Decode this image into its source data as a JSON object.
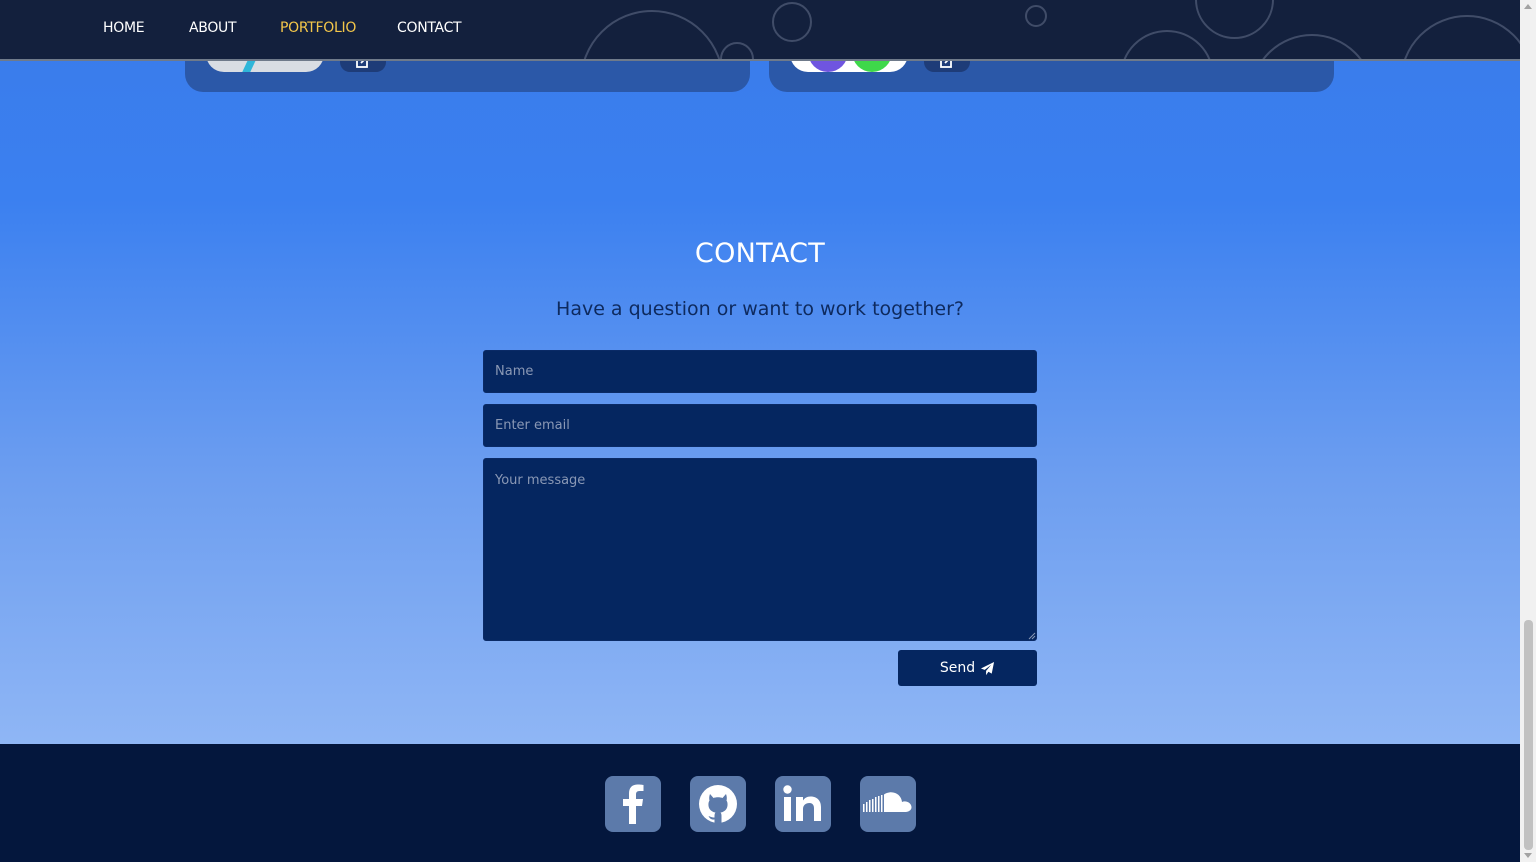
{
  "nav": {
    "items": [
      {
        "label": "HOME",
        "active": false
      },
      {
        "label": "ABOUT",
        "active": false
      },
      {
        "label": "PORTFOLIO",
        "active": true
      },
      {
        "label": "CONTACT",
        "active": false
      }
    ]
  },
  "contact": {
    "title": "CONTACT",
    "subtitle": "Have a question or want to work together?",
    "name_placeholder": "Name",
    "email_placeholder": "Enter email",
    "message_placeholder": "Your message",
    "send_label": "Send"
  },
  "footer": {
    "social": [
      {
        "name": "facebook",
        "icon": "facebook-icon"
      },
      {
        "name": "github",
        "icon": "github-icon"
      },
      {
        "name": "linkedin",
        "icon": "linkedin-icon"
      },
      {
        "name": "soundcloud",
        "icon": "soundcloud-icon"
      }
    ]
  },
  "colors": {
    "nav_bg": "#13203d",
    "active_nav": "#f4c74a",
    "field_bg": "#052660",
    "footer_bg": "#04173d",
    "social_tile": "#5c7aaa"
  }
}
